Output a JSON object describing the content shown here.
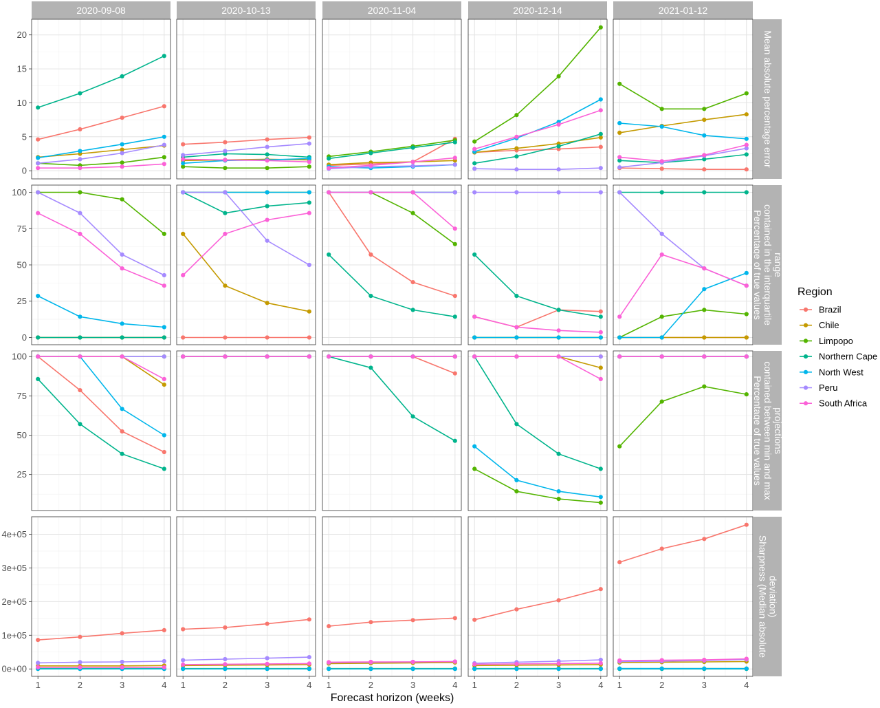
{
  "chart_data": {
    "type": "line",
    "xlabel": "Forecast horizon (weeks)",
    "x": [
      1,
      2,
      3,
      4
    ],
    "columns": [
      "2020-09-08",
      "2020-10-13",
      "2020-11-04",
      "2020-12-14",
      "2021-01-12"
    ],
    "legend": {
      "title": "Region",
      "position": "right"
    },
    "grid": true,
    "regions": [
      {
        "name": "Brazil",
        "color": "#F8766D"
      },
      {
        "name": "Chile",
        "color": "#C49A00"
      },
      {
        "name": "Limpopo",
        "color": "#53B400"
      },
      {
        "name": "Northern Cape",
        "color": "#00B48C"
      },
      {
        "name": "North West",
        "color": "#00B6EB"
      },
      {
        "name": "Peru",
        "color": "#A58AFF"
      },
      {
        "name": "South Africa",
        "color": "#FB61D7"
      }
    ],
    "rows": [
      {
        "label": "Mean absolute percentage error",
        "ylim": [
          -1.2,
          22.3
        ],
        "yticks": [
          0,
          5,
          10,
          15,
          20
        ],
        "ytick_labels": [
          "0",
          "5",
          "10",
          "15",
          "20"
        ],
        "panels": [
          {
            "Brazil": [
              4.6,
              6.1,
              7.8,
              9.5
            ],
            "Chile": [
              2.0,
              2.5,
              3.1,
              3.7
            ],
            "Limpopo": [
              1.1,
              0.8,
              1.2,
              2.0
            ],
            "Northern Cape": [
              9.3,
              11.4,
              13.9,
              16.9
            ],
            "North West": [
              1.9,
              2.9,
              3.9,
              5.0
            ],
            "Peru": [
              1.1,
              1.7,
              2.6,
              3.8
            ],
            "South Africa": [
              0.4,
              0.4,
              0.6,
              1.0
            ]
          },
          {
            "Brazil": [
              3.9,
              4.2,
              4.6,
              4.9
            ],
            "Chile": [
              1.5,
              1.6,
              1.7,
              1.6
            ],
            "Limpopo": [
              0.6,
              0.4,
              0.4,
              0.6
            ],
            "Northern Cape": [
              2.0,
              2.5,
              2.4,
              2.0
            ],
            "North West": [
              1.1,
              1.5,
              1.6,
              1.8
            ],
            "Peru": [
              2.3,
              2.9,
              3.5,
              4.0
            ],
            "South Africa": [
              1.7,
              1.6,
              1.5,
              1.3
            ]
          },
          {
            "Brazil": [
              0.8,
              1.0,
              1.3,
              4.7
            ],
            "Chile": [
              0.9,
              1.2,
              1.3,
              1.5
            ],
            "Limpopo": [
              2.1,
              2.8,
              3.6,
              4.5
            ],
            "Northern Cape": [
              1.8,
              2.6,
              3.4,
              4.2
            ],
            "North West": [
              0.6,
              0.4,
              0.6,
              0.9
            ],
            "Peru": [
              0.3,
              0.6,
              0.7,
              0.9
            ],
            "South Africa": [
              0.4,
              0.8,
              1.3,
              1.9
            ]
          },
          {
            "Brazil": [
              2.7,
              3.0,
              3.2,
              3.5
            ],
            "Chile": [
              2.7,
              3.3,
              4.0,
              4.9
            ],
            "Limpopo": [
              4.3,
              8.2,
              13.9,
              21.1
            ],
            "Northern Cape": [
              1.1,
              2.1,
              3.6,
              5.4
            ],
            "North West": [
              2.8,
              4.8,
              7.2,
              10.5
            ],
            "Peru": [
              0.3,
              0.2,
              0.2,
              0.4
            ],
            "South Africa": [
              3.2,
              5.0,
              6.8,
              8.9
            ]
          },
          {
            "Brazil": [
              0.4,
              0.3,
              0.2,
              0.2
            ],
            "Chile": [
              5.6,
              6.6,
              7.5,
              8.3
            ],
            "Limpopo": [
              12.8,
              9.1,
              9.1,
              11.4
            ],
            "Northern Cape": [
              1.5,
              1.2,
              1.7,
              2.4
            ],
            "North West": [
              7.0,
              6.5,
              5.2,
              4.7
            ],
            "Peru": [
              0.5,
              1.2,
              2.2,
              3.3
            ],
            "South Africa": [
              2.0,
              1.4,
              2.3,
              3.8
            ]
          }
        ]
      },
      {
        "label": "Percentage of true values contained in the interquartile range",
        "ylim": [
          -5,
          105
        ],
        "yticks": [
          0,
          25,
          50,
          75,
          100
        ],
        "ytick_labels": [
          "0",
          "25",
          "50",
          "75",
          "100"
        ],
        "panels": [
          {
            "Brazil": [
              0,
              0,
              0,
              0
            ],
            "Chile": [
              0,
              0,
              0,
              0
            ],
            "Limpopo": [
              100,
              100,
              95.2,
              71.4
            ],
            "Northern Cape": [
              0,
              0,
              0,
              0
            ],
            "North West": [
              28.6,
              14.3,
              9.5,
              7.1
            ],
            "Peru": [
              100,
              85.7,
              57.1,
              42.9
            ],
            "South Africa": [
              85.7,
              71.4,
              47.6,
              35.7
            ]
          },
          {
            "Brazil": [
              0,
              0,
              0,
              0
            ],
            "Chile": [
              71.4,
              35.7,
              23.8,
              17.9
            ],
            "Limpopo": [
              100,
              100,
              100,
              100
            ],
            "Northern Cape": [
              100,
              85.7,
              90.5,
              92.9
            ],
            "North West": [
              100,
              100,
              100,
              100
            ],
            "Peru": [
              100,
              100,
              66.7,
              50.0
            ],
            "South Africa": [
              42.9,
              71.4,
              81.0,
              85.7
            ]
          },
          {
            "Brazil": [
              100,
              57.1,
              38.1,
              28.6
            ],
            "Chile": [
              100,
              100,
              100,
              100
            ],
            "Limpopo": [
              100,
              100,
              85.7,
              64.3
            ],
            "Northern Cape": [
              57.1,
              28.6,
              19.0,
              14.3
            ],
            "North West": [
              100,
              100,
              100,
              100
            ],
            "Peru": [
              100,
              100,
              100,
              100
            ],
            "South Africa": [
              100,
              100,
              100,
              75.0
            ]
          },
          {
            "Brazil": [
              14.3,
              7.1,
              19.0,
              17.9
            ],
            "Chile": [
              0,
              0,
              0,
              0
            ],
            "Limpopo": [
              0,
              0,
              0,
              0
            ],
            "Northern Cape": [
              57.1,
              28.6,
              19.0,
              14.3
            ],
            "North West": [
              0,
              0,
              0,
              0
            ],
            "Peru": [
              100,
              100,
              100,
              100
            ],
            "South Africa": [
              14.3,
              7.1,
              4.8,
              3.6
            ]
          },
          {
            "Brazil": [
              0,
              0,
              0,
              0
            ],
            "Chile": [
              0,
              0,
              0,
              0
            ],
            "Limpopo": [
              0,
              14.3,
              19.0,
              16.1
            ],
            "Northern Cape": [
              100,
              100,
              100,
              100
            ],
            "North West": [
              0,
              0,
              33.3,
              44.4
            ],
            "Peru": [
              100,
              71.4,
              47.6,
              35.7
            ],
            "South Africa": [
              14.3,
              57.1,
              47.6,
              35.7
            ]
          }
        ]
      },
      {
        "label": "Percentage of true values contained between min and max projections",
        "ylim": [
          2.1,
          103.6
        ],
        "yticks": [
          25,
          50,
          75,
          100
        ],
        "ytick_labels": [
          "25",
          "50",
          "75",
          "100"
        ],
        "panels": [
          {
            "Brazil": [
              100,
              78.6,
              52.4,
              39.3
            ],
            "Chile": [
              100,
              100,
              100,
              82.1
            ],
            "Limpopo": [
              100,
              100,
              100,
              100
            ],
            "Northern Cape": [
              85.7,
              57.1,
              38.1,
              28.6
            ],
            "North West": [
              100,
              100,
              66.7,
              50.0
            ],
            "Peru": [
              100,
              100,
              100,
              100
            ],
            "South Africa": [
              100,
              100,
              100,
              85.7
            ]
          },
          {
            "Brazil": [
              100,
              100,
              100,
              100
            ],
            "Chile": [
              100,
              100,
              100,
              100
            ],
            "Limpopo": [
              100,
              100,
              100,
              100
            ],
            "Northern Cape": [
              100,
              100,
              100,
              100
            ],
            "North West": [
              100,
              100,
              100,
              100
            ],
            "Peru": [
              100,
              100,
              100,
              100
            ],
            "South Africa": [
              100,
              100,
              100,
              100
            ]
          },
          {
            "Brazil": [
              100,
              100,
              100,
              89.3
            ],
            "Chile": [
              100,
              100,
              100,
              100
            ],
            "Limpopo": [
              100,
              100,
              100,
              100
            ],
            "Northern Cape": [
              100,
              92.9,
              61.9,
              46.4
            ],
            "North West": [
              100,
              100,
              100,
              100
            ],
            "Peru": [
              100,
              100,
              100,
              100
            ],
            "South Africa": [
              100,
              100,
              100,
              100
            ]
          },
          {
            "Brazil": [
              100,
              100,
              100,
              100
            ],
            "Chile": [
              100,
              100,
              100,
              92.9
            ],
            "Limpopo": [
              28.6,
              14.3,
              9.5,
              7.1
            ],
            "Northern Cape": [
              100,
              57.1,
              38.1,
              28.6
            ],
            "North West": [
              42.9,
              21.4,
              14.3,
              10.7
            ],
            "Peru": [
              100,
              100,
              100,
              100
            ],
            "South Africa": [
              100,
              100,
              100,
              85.7
            ]
          },
          {
            "Brazil": [
              100,
              100,
              100,
              100
            ],
            "Chile": [
              100,
              100,
              100,
              100
            ],
            "Limpopo": [
              42.9,
              71.4,
              81.0,
              76.0
            ],
            "Northern Cape": [
              100,
              100,
              100,
              100
            ],
            "North West": [
              100,
              100,
              100,
              100
            ],
            "Peru": [
              100,
              100,
              100,
              100
            ],
            "South Africa": [
              100,
              100,
              100,
              100
            ]
          }
        ]
      },
      {
        "label": "Sharpness (Median absolute deviation)",
        "ylim": [
          -22000,
          452000
        ],
        "yticks": [
          0,
          100000,
          200000,
          300000,
          400000
        ],
        "ytick_labels": [
          "0e+00",
          "1e+05",
          "2e+05",
          "3e+05",
          "4e+05"
        ],
        "panels": [
          {
            "Brazil": [
              86000,
              95000,
              106000,
              115000
            ],
            "Chile": [
              9000,
              9000,
              9000,
              10000
            ],
            "Limpopo": [
              1000,
              1000,
              1000,
              1000
            ],
            "Northern Cape": [
              0,
              0,
              0,
              0
            ],
            "North West": [
              500,
              500,
              500,
              500
            ],
            "Peru": [
              18000,
              20000,
              21000,
              23000
            ],
            "South Africa": [
              5000,
              5000,
              5000,
              5000
            ]
          },
          {
            "Brazil": [
              118000,
              123000,
              134000,
              147000
            ],
            "Chile": [
              10000,
              11000,
              12000,
              13000
            ],
            "Limpopo": [
              1000,
              1000,
              1000,
              1000
            ],
            "Northern Cape": [
              0,
              0,
              0,
              0
            ],
            "North West": [
              500,
              500,
              500,
              500
            ],
            "Peru": [
              26000,
              29000,
              32000,
              35000
            ],
            "South Africa": [
              13000,
              14000,
              15000,
              16000
            ]
          },
          {
            "Brazil": [
              127000,
              139000,
              145000,
              151000
            ],
            "Chile": [
              16000,
              17000,
              18000,
              19000
            ],
            "Limpopo": [
              1000,
              1000,
              1000,
              1000
            ],
            "Northern Cape": [
              0,
              0,
              0,
              0
            ],
            "North West": [
              500,
              500,
              500,
              500
            ],
            "Peru": [
              19000,
              20000,
              21000,
              22000
            ],
            "South Africa": [
              20000,
              21000,
              21000,
              22000
            ]
          },
          {
            "Brazil": [
              146000,
              177000,
              204000,
              237000
            ],
            "Chile": [
              10000,
              11000,
              12000,
              13000
            ],
            "Limpopo": [
              1000,
              1000,
              1000,
              1000
            ],
            "Northern Cape": [
              0,
              0,
              0,
              0
            ],
            "North West": [
              500,
              500,
              500,
              500
            ],
            "Peru": [
              17000,
              20000,
              23000,
              27000
            ],
            "South Africa": [
              14000,
              15000,
              16000,
              17000
            ]
          },
          {
            "Brazil": [
              317000,
              357000,
              386000,
              428000
            ],
            "Chile": [
              19000,
              20000,
              21000,
              22000
            ],
            "Limpopo": [
              1000,
              1000,
              1000,
              1000
            ],
            "Northern Cape": [
              0,
              0,
              0,
              0
            ],
            "North West": [
              1000,
              1000,
              1000,
              1000
            ],
            "Peru": [
              22000,
              23000,
              25000,
              28000
            ],
            "South Africa": [
              25000,
              26000,
              27000,
              30000
            ]
          }
        ]
      }
    ]
  }
}
